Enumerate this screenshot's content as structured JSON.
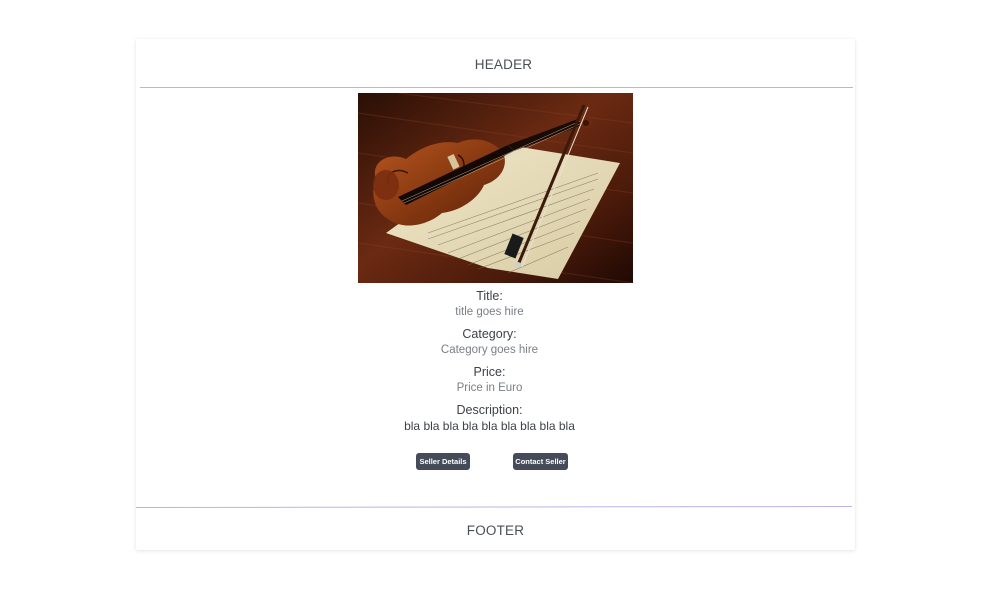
{
  "header": {
    "text": "HEADER"
  },
  "product": {
    "image_alt": "violin-with-bow-on-sheet-music",
    "fields": [
      {
        "label": "Title:",
        "value": "title goes hire"
      },
      {
        "label": "Category:",
        "value": "Category goes hire"
      },
      {
        "label": "Price:",
        "value": "Price in Euro"
      },
      {
        "label": "Description:",
        "value": "bla bla bla bla bla bla bla bla bla"
      }
    ]
  },
  "actions": {
    "seller_details": "Seller Details",
    "contact_seller": "Contact Seller"
  },
  "footer": {
    "text": "FOOTER"
  },
  "colors": {
    "button_bg": "#454b58",
    "divider": "#b9b4e6",
    "text": "#444a53"
  }
}
